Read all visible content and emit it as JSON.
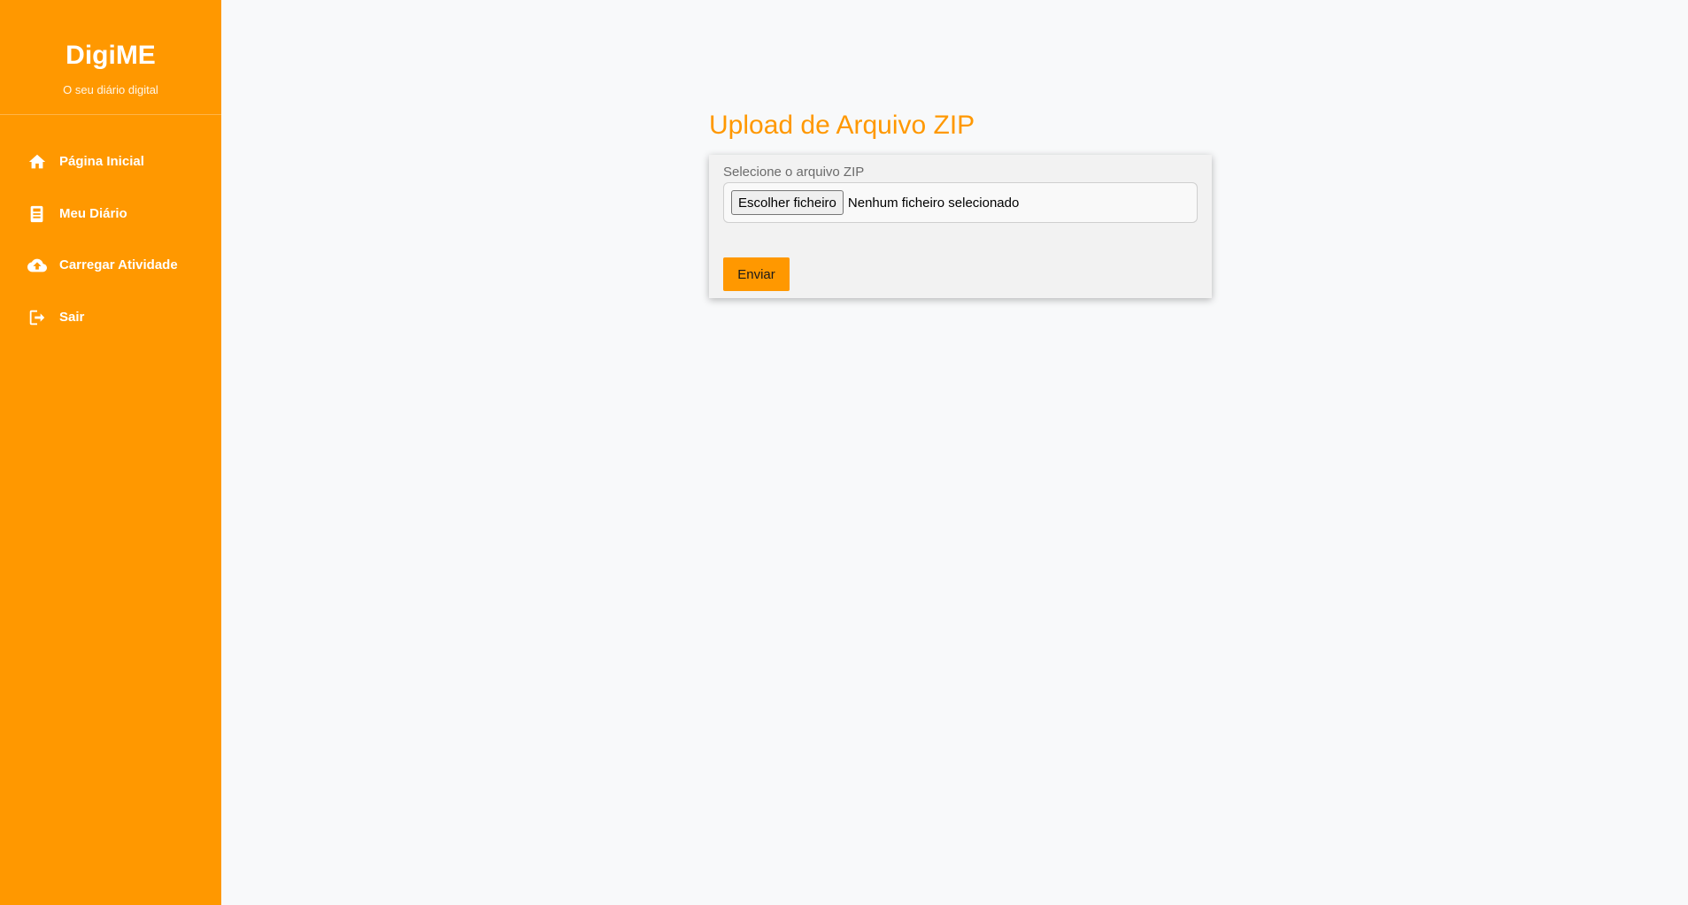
{
  "sidebar": {
    "brand_title": "DigiME",
    "brand_subtitle": "O seu diário digital",
    "items": [
      {
        "label": "Página Inicial",
        "icon": "home-icon"
      },
      {
        "label": "Meu Diário",
        "icon": "book-icon"
      },
      {
        "label": "Carregar Atividade",
        "icon": "cloud-upload-icon"
      },
      {
        "label": "Sair",
        "icon": "logout-icon"
      }
    ]
  },
  "main": {
    "title": "Upload de Arquivo ZIP",
    "form": {
      "field_label": "Selecione o arquivo ZIP",
      "file_button_label": "Escolher ficheiro",
      "file_status": "Nenhum ficheiro selecionado",
      "submit_label": "Enviar"
    }
  },
  "colors": {
    "accent": "#ff9800",
    "background": "#f8f9fa",
    "card": "#f2f2f2"
  }
}
